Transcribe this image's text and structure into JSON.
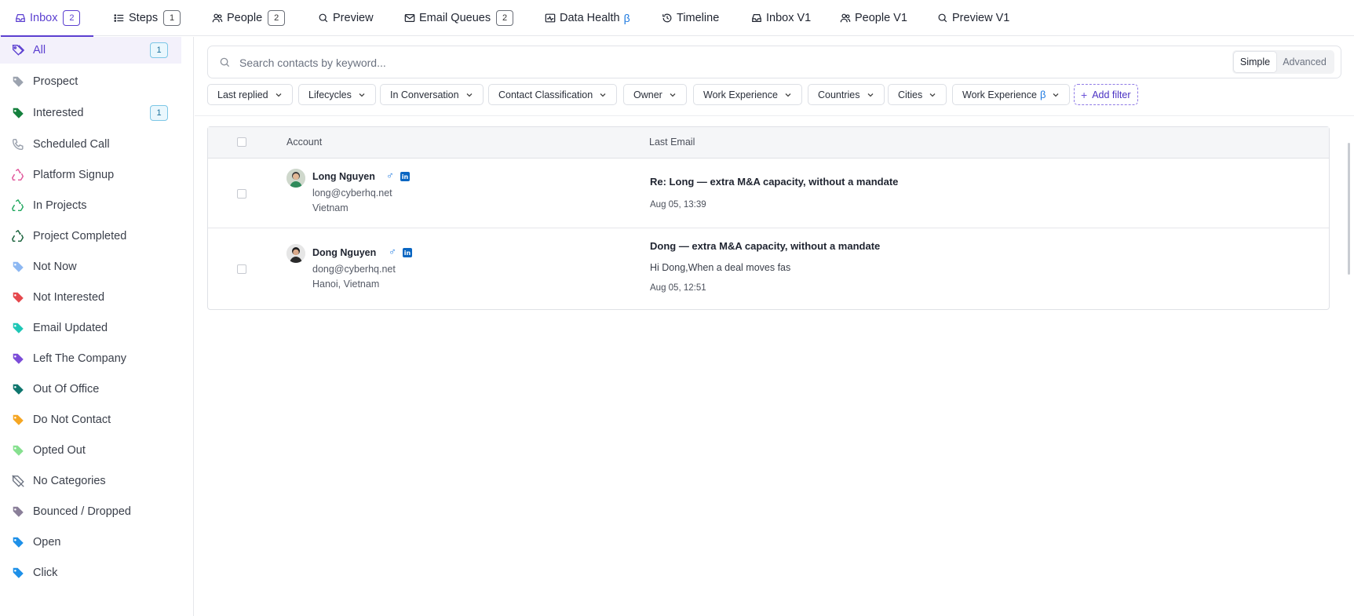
{
  "tabs": [
    {
      "label": "Inbox",
      "count": "2",
      "icon": "inbox-icon"
    },
    {
      "label": "Steps",
      "count": "1",
      "icon": "list-icon"
    },
    {
      "label": "People",
      "count": "2",
      "icon": "people-icon"
    },
    {
      "label": "Preview",
      "icon": "search-icon"
    },
    {
      "label": "Email Queues",
      "count": "2",
      "icon": "mail-icon"
    },
    {
      "label": "Data Health",
      "beta": "β",
      "icon": "health-chart-icon"
    },
    {
      "label": "Timeline",
      "icon": "history-icon"
    },
    {
      "label": "Inbox V1",
      "icon": "inbox-icon"
    },
    {
      "label": "People V1",
      "icon": "people-icon"
    },
    {
      "label": "Preview V1",
      "icon": "search-icon"
    }
  ],
  "sidebar": {
    "items": [
      {
        "label": "All",
        "badge": "1",
        "icon": "tags-icon",
        "color": "#5b3fd0"
      },
      {
        "label": "Prospect",
        "icon": "tag-icon",
        "color": "#9ca3af"
      },
      {
        "label": "Interested",
        "badge": "1",
        "icon": "tag-icon",
        "color": "#15803d"
      },
      {
        "label": "Scheduled Call",
        "icon": "phone-icon",
        "color": "#9ca3af"
      },
      {
        "label": "Platform Signup",
        "icon": "recycle-icon",
        "color": "#e0559a"
      },
      {
        "label": "In Projects",
        "icon": "recycle-icon",
        "color": "#22a860"
      },
      {
        "label": "Project Completed",
        "icon": "recycle-icon",
        "color": "#17603a"
      },
      {
        "label": "Not Now",
        "icon": "tag-icon",
        "color": "#8db8f2"
      },
      {
        "label": "Not Interested",
        "icon": "tag-icon",
        "color": "#e5484d"
      },
      {
        "label": "Email Updated",
        "icon": "tag-icon",
        "color": "#1fc7b6"
      },
      {
        "label": "Left The Company",
        "icon": "tag-icon",
        "color": "#7c4dd8"
      },
      {
        "label": "Out Of Office",
        "icon": "tag-icon",
        "color": "#0f766e"
      },
      {
        "label": "Do Not Contact",
        "icon": "tag-icon",
        "color": "#f5a623"
      },
      {
        "label": "Opted Out",
        "icon": "tag-icon",
        "color": "#86e08f"
      },
      {
        "label": "No Categories",
        "icon": "tag-off-icon",
        "color": "#6b7280"
      },
      {
        "label": "Bounced / Dropped",
        "icon": "tag-icon",
        "color": "#8a7f99"
      },
      {
        "label": "Open",
        "icon": "tag-icon",
        "color": "#1e90e8"
      },
      {
        "label": "Click",
        "icon": "tag-icon",
        "color": "#1e90e8"
      }
    ]
  },
  "search": {
    "placeholder": "Search contacts by keyword...",
    "mode_simple": "Simple",
    "mode_advanced": "Advanced"
  },
  "filters": [
    {
      "label": "Last replied"
    },
    {
      "label": "Lifecycles"
    },
    {
      "label": "In Conversation"
    },
    {
      "label": "Contact Classification"
    },
    {
      "label": "Owner"
    },
    {
      "label": "Work Experience"
    },
    {
      "label": "Countries"
    },
    {
      "label": "Cities"
    },
    {
      "label": "Work Experience",
      "beta": "β"
    }
  ],
  "add_filter_label": "Add filter",
  "table": {
    "headers": {
      "account": "Account",
      "last_email": "Last Email"
    },
    "rows": [
      {
        "name": "Long Nguyen",
        "gender": "♂",
        "linkedin": "in",
        "email": "long@cyberhq.net",
        "location": "Vietnam",
        "subject": "Re: Long — extra M&A capacity, without a mandate",
        "preview": "",
        "time": "Aug 05, 13:39"
      },
      {
        "name": "Dong Nguyen",
        "gender": "♂",
        "linkedin": "in",
        "email": "dong@cyberhq.net",
        "location": "Hanoi, Vietnam",
        "subject": "Dong — extra M&A capacity, without a mandate",
        "preview": "Hi Dong,When a deal moves fas",
        "time": "Aug 05, 12:51"
      }
    ]
  },
  "colors": {
    "accent": "#5b3fd0",
    "beta": "#1f7ae0",
    "linkedin": "#0a66c2"
  }
}
